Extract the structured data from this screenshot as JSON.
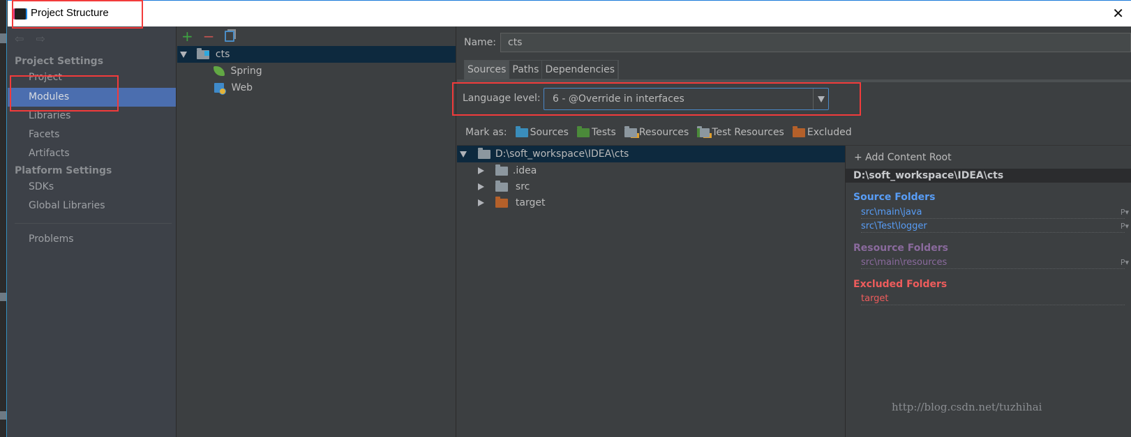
{
  "window": {
    "title": "Project Structure",
    "close_icon": "close-icon"
  },
  "sidebar": {
    "nav_back": "⇦",
    "nav_forward": "⇨",
    "project_settings_header": "Project Settings",
    "project_items": [
      {
        "label": "Project",
        "active": false
      },
      {
        "label": "Modules",
        "active": true
      },
      {
        "label": "Libraries",
        "active": false
      },
      {
        "label": "Facets",
        "active": false
      },
      {
        "label": "Artifacts",
        "active": false
      }
    ],
    "platform_settings_header": "Platform Settings",
    "platform_items": [
      {
        "label": "SDKs"
      },
      {
        "label": "Global Libraries"
      }
    ],
    "problems_label": "Problems"
  },
  "modules": {
    "toolbar": {
      "add": "+",
      "remove": "−"
    },
    "tree": [
      {
        "label": "cts",
        "type": "module",
        "expanded": true,
        "selected": true
      },
      {
        "label": "Spring",
        "type": "facet-spring"
      },
      {
        "label": "Web",
        "type": "facet-web"
      }
    ]
  },
  "module_settings": {
    "name_label": "Name:",
    "name_value": "cts",
    "tabs": [
      {
        "label": "Sources",
        "active": true
      },
      {
        "label": "Paths",
        "active": false
      },
      {
        "label": "Dependencies",
        "active": false
      }
    ],
    "language_level_label": "Language level:",
    "language_level_value": "6 - @Override in interfaces",
    "mark_as_label": "Mark as:",
    "mark_as": [
      {
        "label": "Sources",
        "color": "#3a8dbb"
      },
      {
        "label": "Tests",
        "color": "#4b8a3a"
      },
      {
        "label": "Resources",
        "color": "#8c979f"
      },
      {
        "label": "Test Resources",
        "color": "#8c979f"
      },
      {
        "label": "Excluded",
        "color": "#b4602a"
      }
    ],
    "content_tree": [
      {
        "label": "D:\\soft_workspace\\IDEA\\cts",
        "expanded": true,
        "selected": true,
        "level": 0
      },
      {
        "label": ".idea",
        "expanded": false,
        "level": 1,
        "color": "#8c979f"
      },
      {
        "label": "src",
        "expanded": false,
        "level": 1,
        "color": "#8c979f"
      },
      {
        "label": "target",
        "expanded": false,
        "level": 1,
        "color": "#b4602a"
      }
    ],
    "roots": {
      "add_content_root": "+ Add Content Root",
      "root_path": "D:\\soft_workspace\\IDEA\\cts",
      "source_folders_title": "Source Folders",
      "source_folders": [
        "src\\main\\java",
        "src\\Test\\logger"
      ],
      "resource_folders_title": "Resource Folders",
      "resource_folders": [
        "src\\main\\resources"
      ],
      "excluded_folders_title": "Excluded Folders",
      "excluded_folders": [
        "target"
      ],
      "package_prefix_icon": "P▾"
    }
  },
  "colors": {
    "accent_selection": "#4b6eaf",
    "source": "#589df6",
    "resource": "#8a6a9d",
    "excluded": "#ee5c5c",
    "annotation_red": "#f23b3b"
  },
  "watermark": "http://blog.csdn.net/tuzhihai"
}
